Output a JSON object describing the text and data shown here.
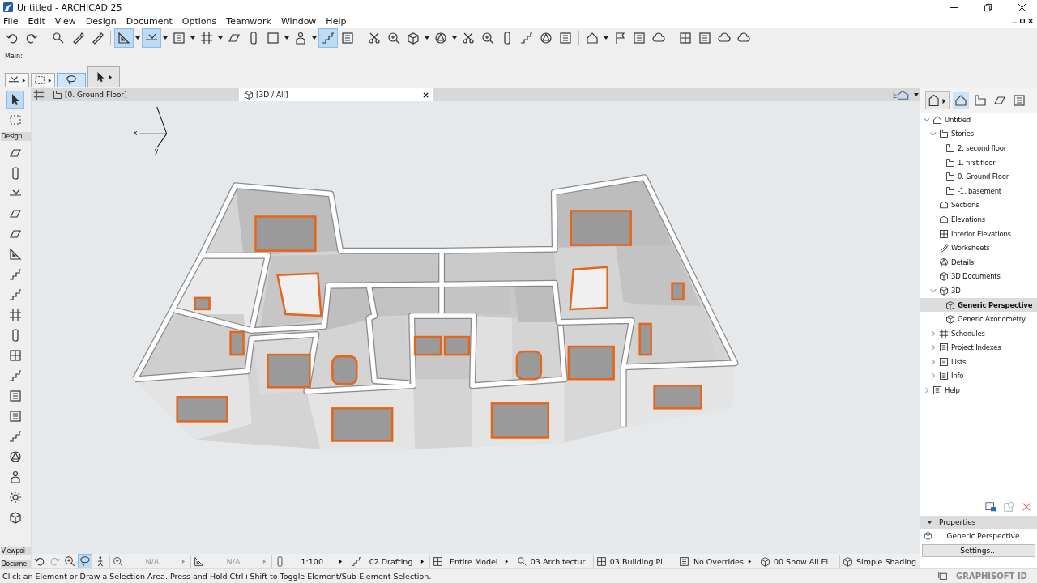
{
  "window": {
    "title": "Untitled - ARCHICAD 25"
  },
  "menu": [
    "File",
    "Edit",
    "View",
    "Design",
    "Document",
    "Options",
    "Teamwork",
    "Window",
    "Help"
  ],
  "toolbar_buttons": [
    {
      "selected": false
    },
    {
      "selected": false
    },
    {
      "selected": false
    },
    {
      "selected": false
    },
    {
      "selected": false
    },
    {
      "selected": true
    },
    {
      "selected": true
    },
    {
      "selected": false
    },
    {
      "selected": false
    },
    {
      "selected": false
    },
    {
      "selected": false
    },
    {
      "selected": false
    },
    {
      "selected": false
    },
    {
      "selected": true
    },
    {
      "selected": false
    },
    {
      "selected": false
    },
    {
      "selected": false
    },
    {
      "selected": false
    },
    {
      "selected": false
    },
    {
      "selected": false
    },
    {
      "selected": false
    },
    {
      "selected": false
    },
    {
      "selected": false
    },
    {
      "selected": false
    },
    {
      "selected": false
    },
    {
      "selected": false
    },
    {
      "selected": false
    },
    {
      "selected": false
    },
    {
      "selected": false
    },
    {
      "selected": false
    },
    {
      "selected": false
    },
    {
      "selected": false
    },
    {
      "selected": false
    }
  ],
  "main_toolbar": {
    "label": "Main:",
    "buttons": [
      {
        "selected": false
      },
      {
        "selected": false
      },
      {
        "selected": true
      },
      {
        "selected": false
      }
    ]
  },
  "tabs": [
    {
      "label": "[0. Ground Floor]",
      "selected": false
    },
    {
      "label": "[3D / All]",
      "selected": true
    }
  ],
  "toolbox": {
    "sections": [
      "Design",
      "Viewpoi",
      "Docume"
    ],
    "tools": [
      {
        "selected": true
      },
      {
        "selected": false
      },
      {
        "selected": false
      },
      {
        "selected": false
      },
      {
        "selected": false
      },
      {
        "selected": false
      },
      {
        "selected": false
      },
      {
        "selected": false
      },
      {
        "selected": false
      },
      {
        "selected": false
      },
      {
        "selected": false
      },
      {
        "selected": false
      },
      {
        "selected": false
      },
      {
        "selected": false
      },
      {
        "selected": false
      },
      {
        "selected": false
      },
      {
        "selected": false
      },
      {
        "selected": false
      },
      {
        "selected": false
      },
      {
        "selected": false
      },
      {
        "selected": false
      }
    ]
  },
  "axes": {
    "labels": [
      "x",
      "y"
    ]
  },
  "navigator": {
    "tree": [
      {
        "label": "Untitled",
        "expanded": true,
        "selected": false,
        "children": [
          {
            "label": "Stories",
            "expanded": true,
            "selected": false,
            "children": [
              {
                "label": "2. second floor",
                "selected": false
              },
              {
                "label": "1. first floor",
                "selected": false
              },
              {
                "label": "0. Ground Floor",
                "selected": false
              },
              {
                "label": "-1. basement",
                "selected": false
              }
            ]
          },
          {
            "label": "Sections",
            "selected": false
          },
          {
            "label": "Elevations",
            "selected": false
          },
          {
            "label": "Interior Elevations",
            "selected": false
          },
          {
            "label": "Worksheets",
            "selected": false
          },
          {
            "label": "Details",
            "selected": false
          },
          {
            "label": "3D Documents",
            "selected": false
          },
          {
            "label": "3D",
            "expanded": true,
            "selected": false,
            "children": [
              {
                "label": "Generic Perspective",
                "selected": true
              },
              {
                "label": "Generic Axonometry",
                "selected": false
              }
            ]
          },
          {
            "label": "Schedules",
            "expanded": false,
            "selected": false
          },
          {
            "label": "Project Indexes",
            "expanded": false,
            "selected": false
          },
          {
            "label": "Lists",
            "expanded": false,
            "selected": false
          },
          {
            "label": "Info",
            "expanded": false,
            "selected": false
          }
        ]
      },
      {
        "label": "Help",
        "expanded": false,
        "selected": false
      }
    ]
  },
  "properties": {
    "title": "Properties",
    "value": "Generic Perspective",
    "button": "Settings..."
  },
  "view_bar": {
    "items": [
      {
        "text": "N/A",
        "disabled": true
      },
      {
        "text": "N/A",
        "disabled": true
      },
      {
        "text": "1:100",
        "disabled": false
      },
      {
        "text": "02 Drafting",
        "disabled": false
      },
      {
        "text": "Entire Model",
        "disabled": false
      },
      {
        "text": "03 Architectur...",
        "disabled": false
      },
      {
        "text": "03 Building Pl...",
        "disabled": false
      },
      {
        "text": "No Overrides",
        "disabled": false
      },
      {
        "text": "00 Show All El...",
        "disabled": false
      },
      {
        "text": "Simple Shading",
        "disabled": false
      }
    ]
  },
  "status_bar": {
    "message": "Click an Element or Draw a Selection Area. Press and Hold Ctrl+Shift to Toggle Element/Sub-Element Selection.",
    "account": "GRAPHISOFT ID"
  }
}
